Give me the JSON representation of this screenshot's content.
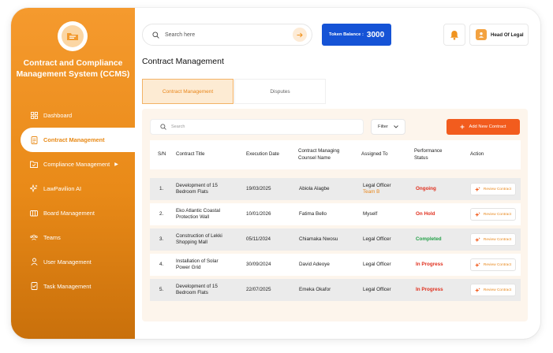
{
  "app": {
    "title": "Contract and Compliance Management System (CCMS)"
  },
  "sidebar": {
    "items": [
      {
        "label": "Dashboard",
        "icon": "grid-icon",
        "active": false
      },
      {
        "label": "Contract Management",
        "icon": "document-icon",
        "active": true
      },
      {
        "label": "Compliance Management",
        "icon": "folder-check-icon",
        "active": false
      },
      {
        "label": "LawPavilion AI",
        "icon": "sparkle-icon",
        "active": false
      },
      {
        "label": "Board Management",
        "icon": "board-icon",
        "active": false
      },
      {
        "label": "Teams",
        "icon": "users-icon",
        "active": false
      },
      {
        "label": "User Management",
        "icon": "user-icon",
        "active": false
      },
      {
        "label": "Task Management",
        "icon": "task-icon",
        "active": false
      }
    ]
  },
  "header": {
    "search_placeholder": "Search here",
    "token_label": "Token Balance :",
    "token_value": "3000",
    "user_role": "Head Of Legal"
  },
  "page": {
    "title": "Contract Management",
    "tabs": [
      {
        "label": "Contract Management",
        "active": true
      },
      {
        "label": "Disputes",
        "active": false
      }
    ]
  },
  "toolbar": {
    "search_placeholder": "Search",
    "filter_label": "Filter",
    "add_label": "Add New Contract"
  },
  "table": {
    "headers": [
      "S/N",
      "Contract Title",
      "Execution Date",
      "Contract Managing Counsel Name",
      "Assigned To",
      "Performance Status",
      "Action"
    ],
    "rows": [
      {
        "sn": "1.",
        "title": "Development of 15 Bedroom Flats",
        "date": "19/03/2025",
        "counsel": "Abiola Alagbe",
        "assigned": "Legal Officer",
        "assigned_sub": "Team B",
        "status": "Ongoing",
        "status_color": "#e0301e",
        "action": "Review Contract"
      },
      {
        "sn": "2.",
        "title": "Eko Atlantic Coastal Protection Wall",
        "date": "10/01/2026",
        "counsel": "Fatima Bello",
        "assigned": "Myself",
        "assigned_sub": "",
        "status": "On Hold",
        "status_color": "#e0301e",
        "action": "Review Contract"
      },
      {
        "sn": "3.",
        "title": "Construction of Lekki Shopping Mall",
        "date": "05/11/2024",
        "counsel": "Chiamaka Nwosu",
        "assigned": "Legal Officer",
        "assigned_sub": "",
        "status": "Completed",
        "status_color": "#23a047",
        "action": "Review Contract"
      },
      {
        "sn": "4.",
        "title": "Installation of Solar Power Grid",
        "date": "30/09/2024",
        "counsel": "David Adeoye",
        "assigned": "Legal Officer",
        "assigned_sub": "",
        "status": "In Progress",
        "status_color": "#e0301e",
        "action": "Review Contract"
      },
      {
        "sn": "5.",
        "title": "Development of 15 Bedroom Flats",
        "date": "22/07/2025",
        "counsel": "Emeka Okafor",
        "assigned": "Legal Officer",
        "assigned_sub": "",
        "status": "In Progress",
        "status_color": "#e0301e",
        "action": "Review Contract"
      }
    ]
  },
  "colors": {
    "brand_orange": "#f0931f",
    "cta_orange": "#f25c1e",
    "token_blue": "#1553d6",
    "status_red": "#e0301e",
    "status_green": "#23a047"
  }
}
